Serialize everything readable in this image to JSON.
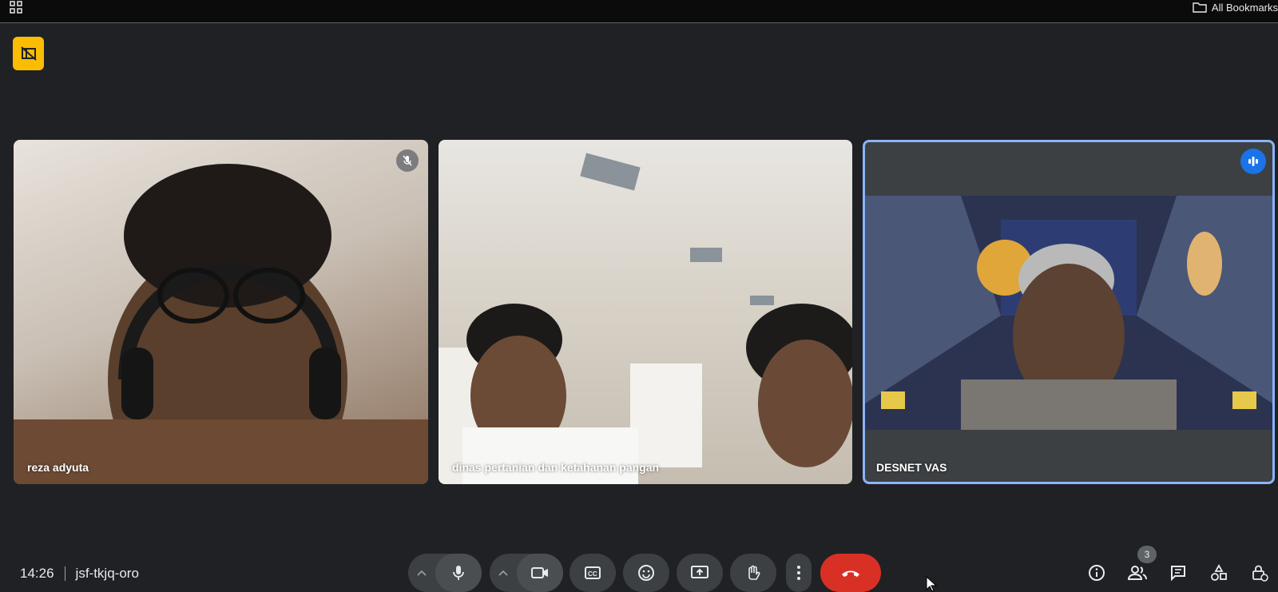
{
  "browser": {
    "bookmarks_label": "All Bookmarks"
  },
  "tiles": [
    {
      "name": "reza adyuta",
      "muted": true,
      "speaking": false
    },
    {
      "name": "dinas pertanian dan ketahanan pangan",
      "muted": false,
      "speaking": false
    },
    {
      "name": "DESNET VAS",
      "muted": false,
      "speaking": true
    }
  ],
  "meeting": {
    "time": "14:26",
    "code": "jsf-tkjq-oro"
  },
  "people": {
    "count": "3"
  },
  "colors": {
    "background": "#202124",
    "control_bg": "#3c4043",
    "end_call": "#d93025",
    "active_border": "#8ab4f8",
    "speaking": "#1a73e8",
    "warning": "#fbbc04"
  },
  "icons": {
    "apps": "apps-grid-icon",
    "folder": "folder-icon",
    "warning": "no-sidebar-icon",
    "muted": "mic-off-icon",
    "speaking": "audio-bars-icon",
    "mic": "mic-icon",
    "camera": "videocam-icon",
    "captions": "closed-caption-icon",
    "emoji": "emoji-icon",
    "present": "present-screen-icon",
    "hand": "raise-hand-icon",
    "more": "more-vert-icon",
    "end": "call-end-icon",
    "info": "info-icon",
    "people": "people-icon",
    "chat": "chat-icon",
    "activities": "activities-icon",
    "host": "host-controls-icon"
  }
}
